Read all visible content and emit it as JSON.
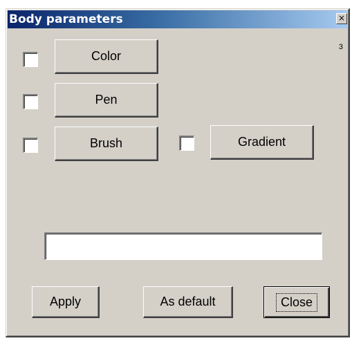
{
  "window": {
    "title": "Body parameters",
    "close_glyph": "×",
    "corner_number": "3"
  },
  "rows": [
    {
      "checkbox_checked": false,
      "button_label": "Color"
    },
    {
      "checkbox_checked": false,
      "button_label": "Pen"
    },
    {
      "checkbox_checked": false,
      "button_label": "Brush"
    }
  ],
  "gradient": {
    "checkbox_checked": false,
    "button_label": "Gradient"
  },
  "text_field": {
    "value": ""
  },
  "footer": {
    "apply_label": "Apply",
    "default_label": "As default",
    "close_label": "Close"
  },
  "colors": {
    "face": "#d4d0c8",
    "title_start": "#0a246a",
    "title_end": "#a6caf0"
  }
}
